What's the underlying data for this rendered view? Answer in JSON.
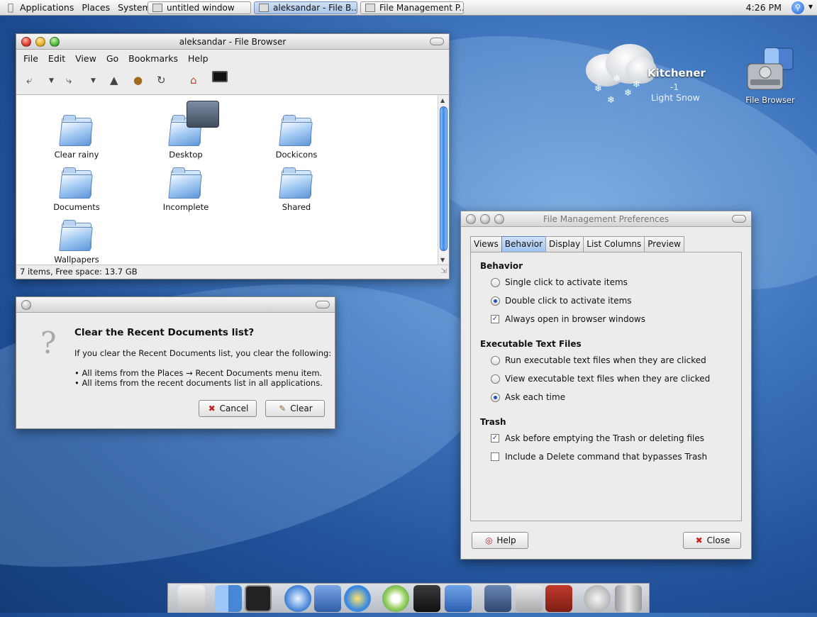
{
  "top_panel": {
    "menus": [
      "Applications",
      "Places",
      "System"
    ],
    "tasks": [
      {
        "label": "untitled window"
      },
      {
        "label": "aleksandar - File B..."
      },
      {
        "label": "File Management P..."
      }
    ],
    "clock": "4:26 PM"
  },
  "file_browser": {
    "title": "aleksandar - File Browser",
    "menu": [
      "File",
      "Edit",
      "View",
      "Go",
      "Bookmarks",
      "Help"
    ],
    "folders": [
      "Clear rainy",
      "Desktop",
      "Dockicons",
      "Documents",
      "Incomplete",
      "Shared",
      "Wallpapers"
    ],
    "status": "7 items, Free space: 13.7 GB"
  },
  "clear_dialog": {
    "heading": "Clear the Recent Documents list?",
    "body": "If you clear the Recent Documents list, you clear the following:",
    "bullet1": "• All items from the Places → Recent Documents menu item.",
    "bullet2": "• All items from the recent documents list in all applications.",
    "cancel_label": "Cancel",
    "clear_label": "Clear"
  },
  "prefs": {
    "title": "File Management Preferences",
    "tabs": [
      "Views",
      "Behavior",
      "Display",
      "List Columns",
      "Preview"
    ],
    "active_tab": "Behavior",
    "behavior_heading": "Behavior",
    "single_click": "Single click to activate items",
    "double_click": "Double click to activate items",
    "always_open": "Always open in browser windows",
    "exec_heading": "Executable Text Files",
    "run_exec": "Run executable text files when they are clicked",
    "view_exec": "View executable text files when they are clicked",
    "ask_each": "Ask each time",
    "trash_heading": "Trash",
    "ask_trash": "Ask before emptying the Trash or deleting files",
    "include_delete": "Include a Delete command that bypasses Trash",
    "help_label": "Help",
    "close_label": "Close"
  },
  "weather": {
    "city": "Kitchener",
    "temp": "-1",
    "condition": "Light Snow"
  },
  "desktop_icon": {
    "label": "File Browser"
  },
  "colors": {
    "accent": "#3b88e6",
    "desktop": "#2a5ea8"
  }
}
